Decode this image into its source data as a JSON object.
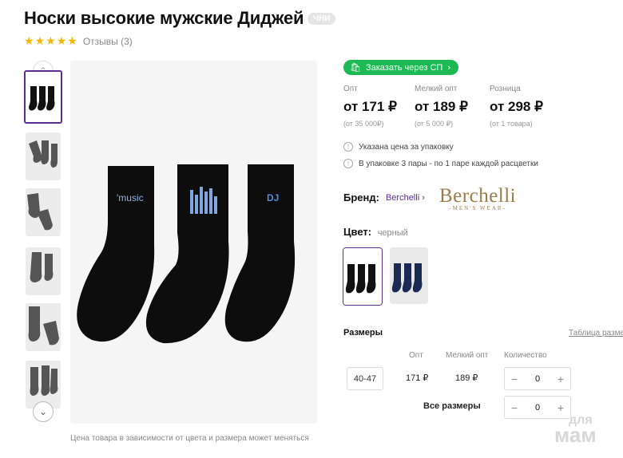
{
  "product": {
    "title": "Носки высокие мужские Диджей",
    "badge": "ЧНИ",
    "rating_stars": 5,
    "reviews": "Отзывы (3)"
  },
  "gallery": {
    "caption": "Цена товара в зависимости от цвета и размера может меняться"
  },
  "order_button": "Заказать через СП",
  "prices": [
    {
      "label": "Опт",
      "value": "от 171 ₽",
      "note": "(от 35 000₽)"
    },
    {
      "label": "Мелкий опт",
      "value": "от 189 ₽",
      "note": "(от 5 000 ₽)"
    },
    {
      "label": "Розница",
      "value": "от 298 ₽",
      "note": "(от 1 товара)"
    }
  ],
  "info": [
    "Указана цена за упаковку",
    "В упаковке 3 пары - по 1 паре каждой расцветки"
  ],
  "brand": {
    "label": "Бренд:",
    "name": "Berchelli",
    "logo_main": "Berchelli",
    "logo_sub": "-MEN'S WEAR-"
  },
  "color": {
    "label": "Цвет:",
    "value": "черный"
  },
  "sizes": {
    "title": "Размеры",
    "table_link": "Таблица разме",
    "headers": [
      "Опт",
      "Мелкий опт",
      "Количество"
    ],
    "rows": [
      {
        "size": "40-47",
        "opt": "171 ₽",
        "small_opt": "189 ₽",
        "qty": "0"
      }
    ],
    "all_label": "Все размеры",
    "all_qty": "0"
  },
  "watermark": {
    "line1": "для",
    "line2": "мам"
  },
  "colors": {
    "accent": "#5b2d90",
    "green": "#1db954",
    "star": "#f5b60a"
  }
}
